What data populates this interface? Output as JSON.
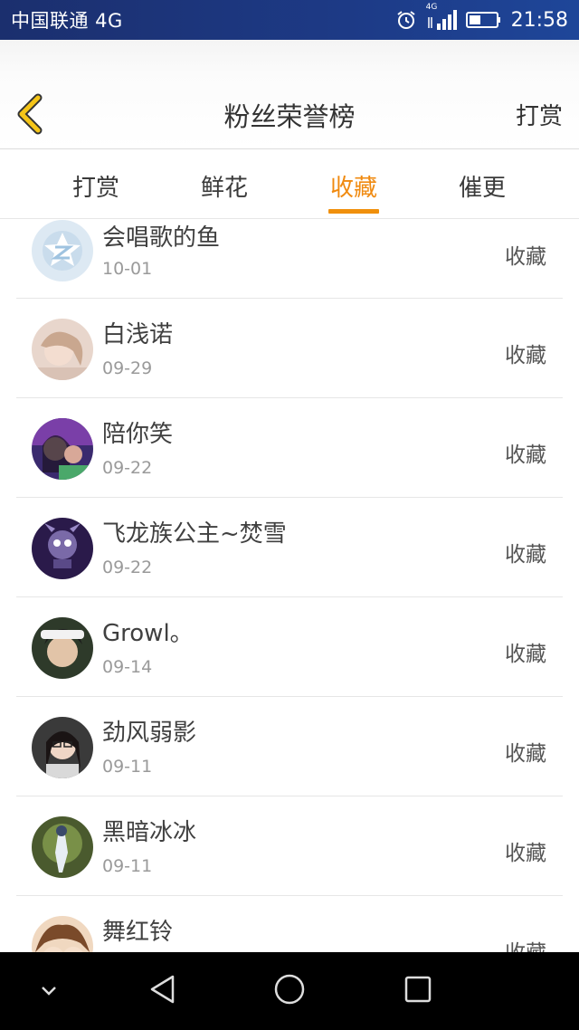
{
  "status_bar": {
    "carrier": "中国联通 4G",
    "network_badge": "4G",
    "time": "21:58",
    "icons": [
      "alarm-icon",
      "signal-icon",
      "battery-icon"
    ]
  },
  "header": {
    "title": "粉丝荣誉榜",
    "action": "打赏",
    "back_icon": "chevron-left-icon",
    "accent_color": "#f0900c"
  },
  "tabs": [
    {
      "label": "打赏",
      "active": false
    },
    {
      "label": "鲜花",
      "active": false
    },
    {
      "label": "收藏",
      "active": true
    },
    {
      "label": "催更",
      "active": false
    }
  ],
  "fans": [
    {
      "name": "会唱歌的鱼",
      "date": "10-01",
      "action": "收藏"
    },
    {
      "name": "白浅诺",
      "date": "09-29",
      "action": "收藏"
    },
    {
      "name": "陪你笑",
      "date": "09-22",
      "action": "收藏"
    },
    {
      "name": "飞龙族公主~焚雪",
      "date": "09-22",
      "action": "收藏"
    },
    {
      "name": "Growl。",
      "date": "09-14",
      "action": "收藏"
    },
    {
      "name": "劲风弱影",
      "date": "09-11",
      "action": "收藏"
    },
    {
      "name": "黑暗冰冰",
      "date": "09-11",
      "action": "收藏"
    },
    {
      "name": "舞红铃",
      "date": "",
      "action": "收藏"
    }
  ],
  "nav_bar": {
    "icons": [
      "chevron-down-icon",
      "back-triangle-icon",
      "home-circle-icon",
      "recents-square-icon"
    ]
  }
}
